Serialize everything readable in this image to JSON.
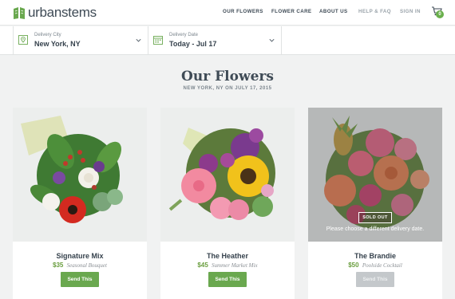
{
  "header": {
    "logo_text": "urbanstems",
    "nav": [
      "OUR FLOWERS",
      "FLOWER CARE",
      "ABOUT US",
      "HELP & FAQ",
      "SIGN IN"
    ],
    "cart_count": "0"
  },
  "filters": {
    "city_label": "Delivery City",
    "city_value": "New York, NY",
    "date_label": "Delivery Date",
    "date_value": "Today - Jul 17"
  },
  "main": {
    "title": "Our Flowers",
    "subtitle": "NEW YORK, NY ON JULY 17, 2015"
  },
  "products": [
    {
      "name": "Signature Mix",
      "price": "$35",
      "tagline": "Seasonal Bouquet",
      "button": "Send This"
    },
    {
      "name": "The Heather",
      "price": "$45",
      "tagline": "Summer Market Mix",
      "button": "Send This"
    },
    {
      "name": "The Brandie",
      "price": "$50",
      "tagline": "Poolside Cocktail",
      "button": "Send This",
      "sold_out": "SOLD OUT",
      "sold_out_message": "Please choose a different delivery date."
    }
  ],
  "colors": {
    "accent": "#6aa84f",
    "text": "#36424d",
    "disabled": "#c4c8cb"
  },
  "icons": [
    "logo-book-icon",
    "cart-icon",
    "location-pin-icon",
    "calendar-icon",
    "chevron-down-icon"
  ]
}
